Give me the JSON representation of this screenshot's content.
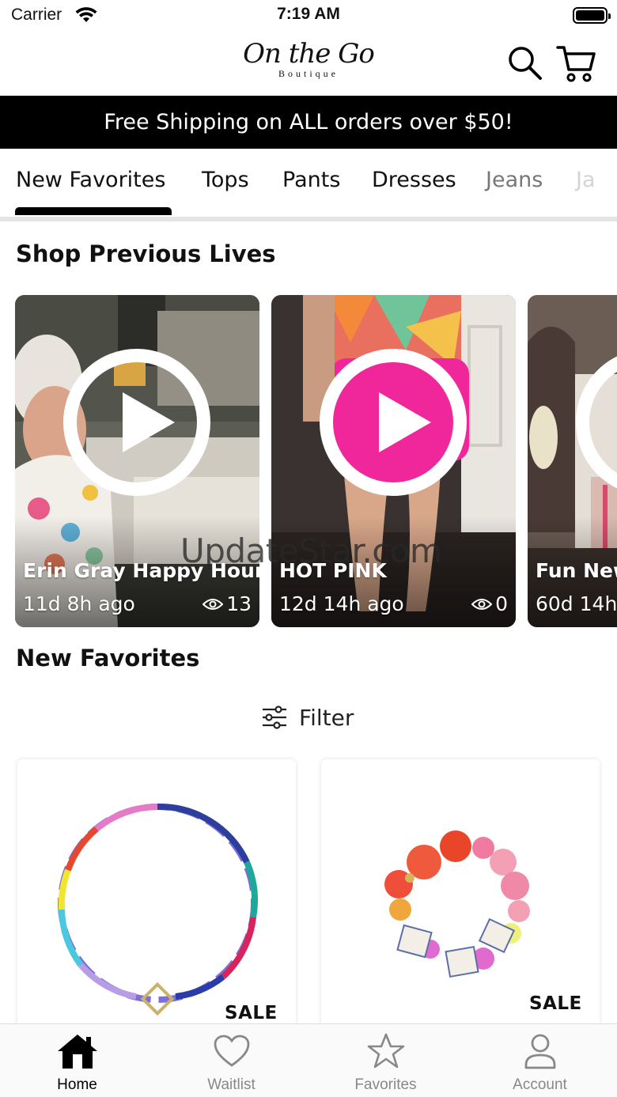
{
  "status_bar": {
    "carrier": "Carrier",
    "time": "7:19 AM"
  },
  "header": {
    "logo_script": "On the Go",
    "logo_sub": "Boutique",
    "search_icon": "search-icon",
    "cart_icon": "cart-icon"
  },
  "promo": {
    "text": "Free Shipping on ALL orders over $50!"
  },
  "tabs": [
    {
      "label": "New Favorites"
    },
    {
      "label": "Tops"
    },
    {
      "label": "Pants"
    },
    {
      "label": "Dresses"
    },
    {
      "label": "Jeans"
    },
    {
      "label": "Ja"
    }
  ],
  "lives_section": {
    "title": "Shop Previous Lives"
  },
  "lives": [
    {
      "title": "Erin Gray Happy Hour",
      "time": "11d 8h ago",
      "views": "13"
    },
    {
      "title": "HOT PINK",
      "time": "12d 14h ago",
      "views": "0"
    },
    {
      "title": "Fun New",
      "time": "60d 14h"
    }
  ],
  "watermark": "UpdateStar.com",
  "favorites_section": {
    "title": "New Favorites",
    "filter_label": "Filter"
  },
  "products": [
    {
      "badge": "SALE"
    },
    {
      "badge": "SALE"
    }
  ],
  "bottom_nav": [
    {
      "label": "Home",
      "icon": "home-icon"
    },
    {
      "label": "Waitlist",
      "icon": "heart-icon"
    },
    {
      "label": "Favorites",
      "icon": "star-icon"
    },
    {
      "label": "Account",
      "icon": "user-icon"
    }
  ],
  "colors": {
    "accent_pink": "#f0279b",
    "black": "#000000"
  }
}
